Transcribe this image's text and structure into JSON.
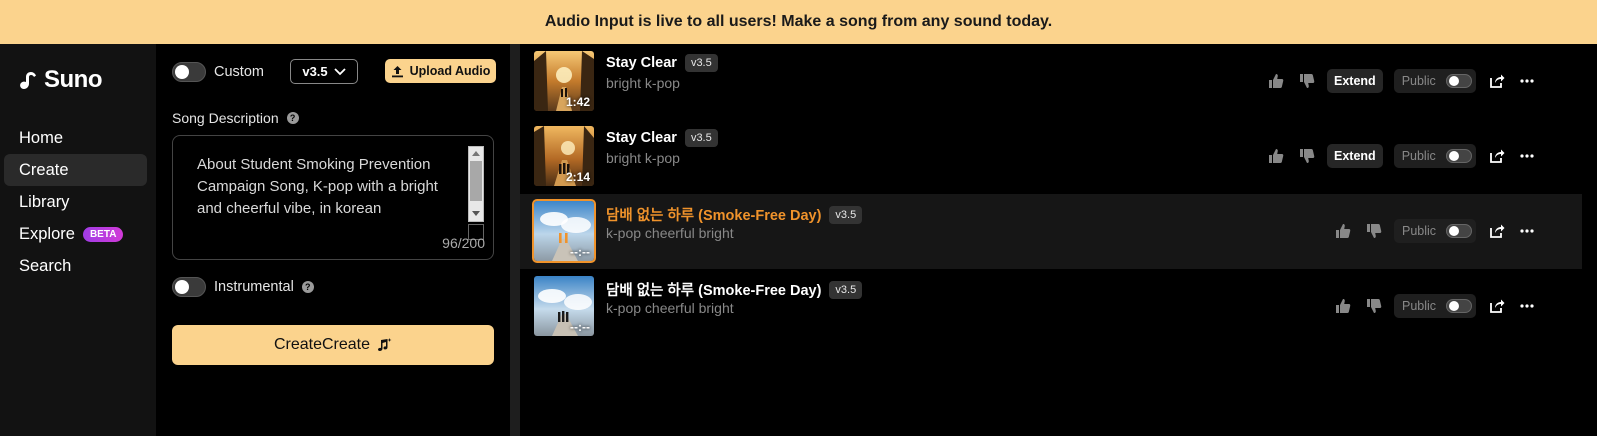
{
  "banner": {
    "text": "Audio Input is live to all users! Make a song from any sound today."
  },
  "sidebar": {
    "logo": "Suno",
    "items": [
      {
        "label": "Home"
      },
      {
        "label": "Create"
      },
      {
        "label": "Library"
      },
      {
        "label": "Explore",
        "badge": "BETA"
      },
      {
        "label": "Search"
      }
    ]
  },
  "create": {
    "custom_label": "Custom",
    "version": "v3.5",
    "upload_label": "Upload Audio",
    "description_label": "Song Description",
    "description_value": "About Student Smoking Prevention Campaign Song, K-pop with a bright and cheerful vibe, in korean",
    "char_count": "96/200",
    "instrumental_label": "Instrumental",
    "create_button": "CreateCreate"
  },
  "songs": [
    {
      "title": "Stay Clear",
      "version": "v3.5",
      "style": "bright k-pop",
      "duration": "1:42",
      "extend": "Extend",
      "public": "Public"
    },
    {
      "title": "Stay Clear",
      "version": "v3.5",
      "style": "bright k-pop",
      "duration": "2:14",
      "extend": "Extend",
      "public": "Public"
    },
    {
      "title": "담배 없는 하루 (Smoke-Free Day)",
      "version": "v3.5",
      "style": "k-pop cheerful bright",
      "duration": "--:--",
      "public": "Public"
    },
    {
      "title": "담배 없는 하루 (Smoke-Free Day)",
      "version": "v3.5",
      "style": "k-pop cheerful bright",
      "duration": "--:--",
      "public": "Public"
    }
  ],
  "colors": {
    "accent": "#fbd38d",
    "playing": "#f0932b"
  }
}
